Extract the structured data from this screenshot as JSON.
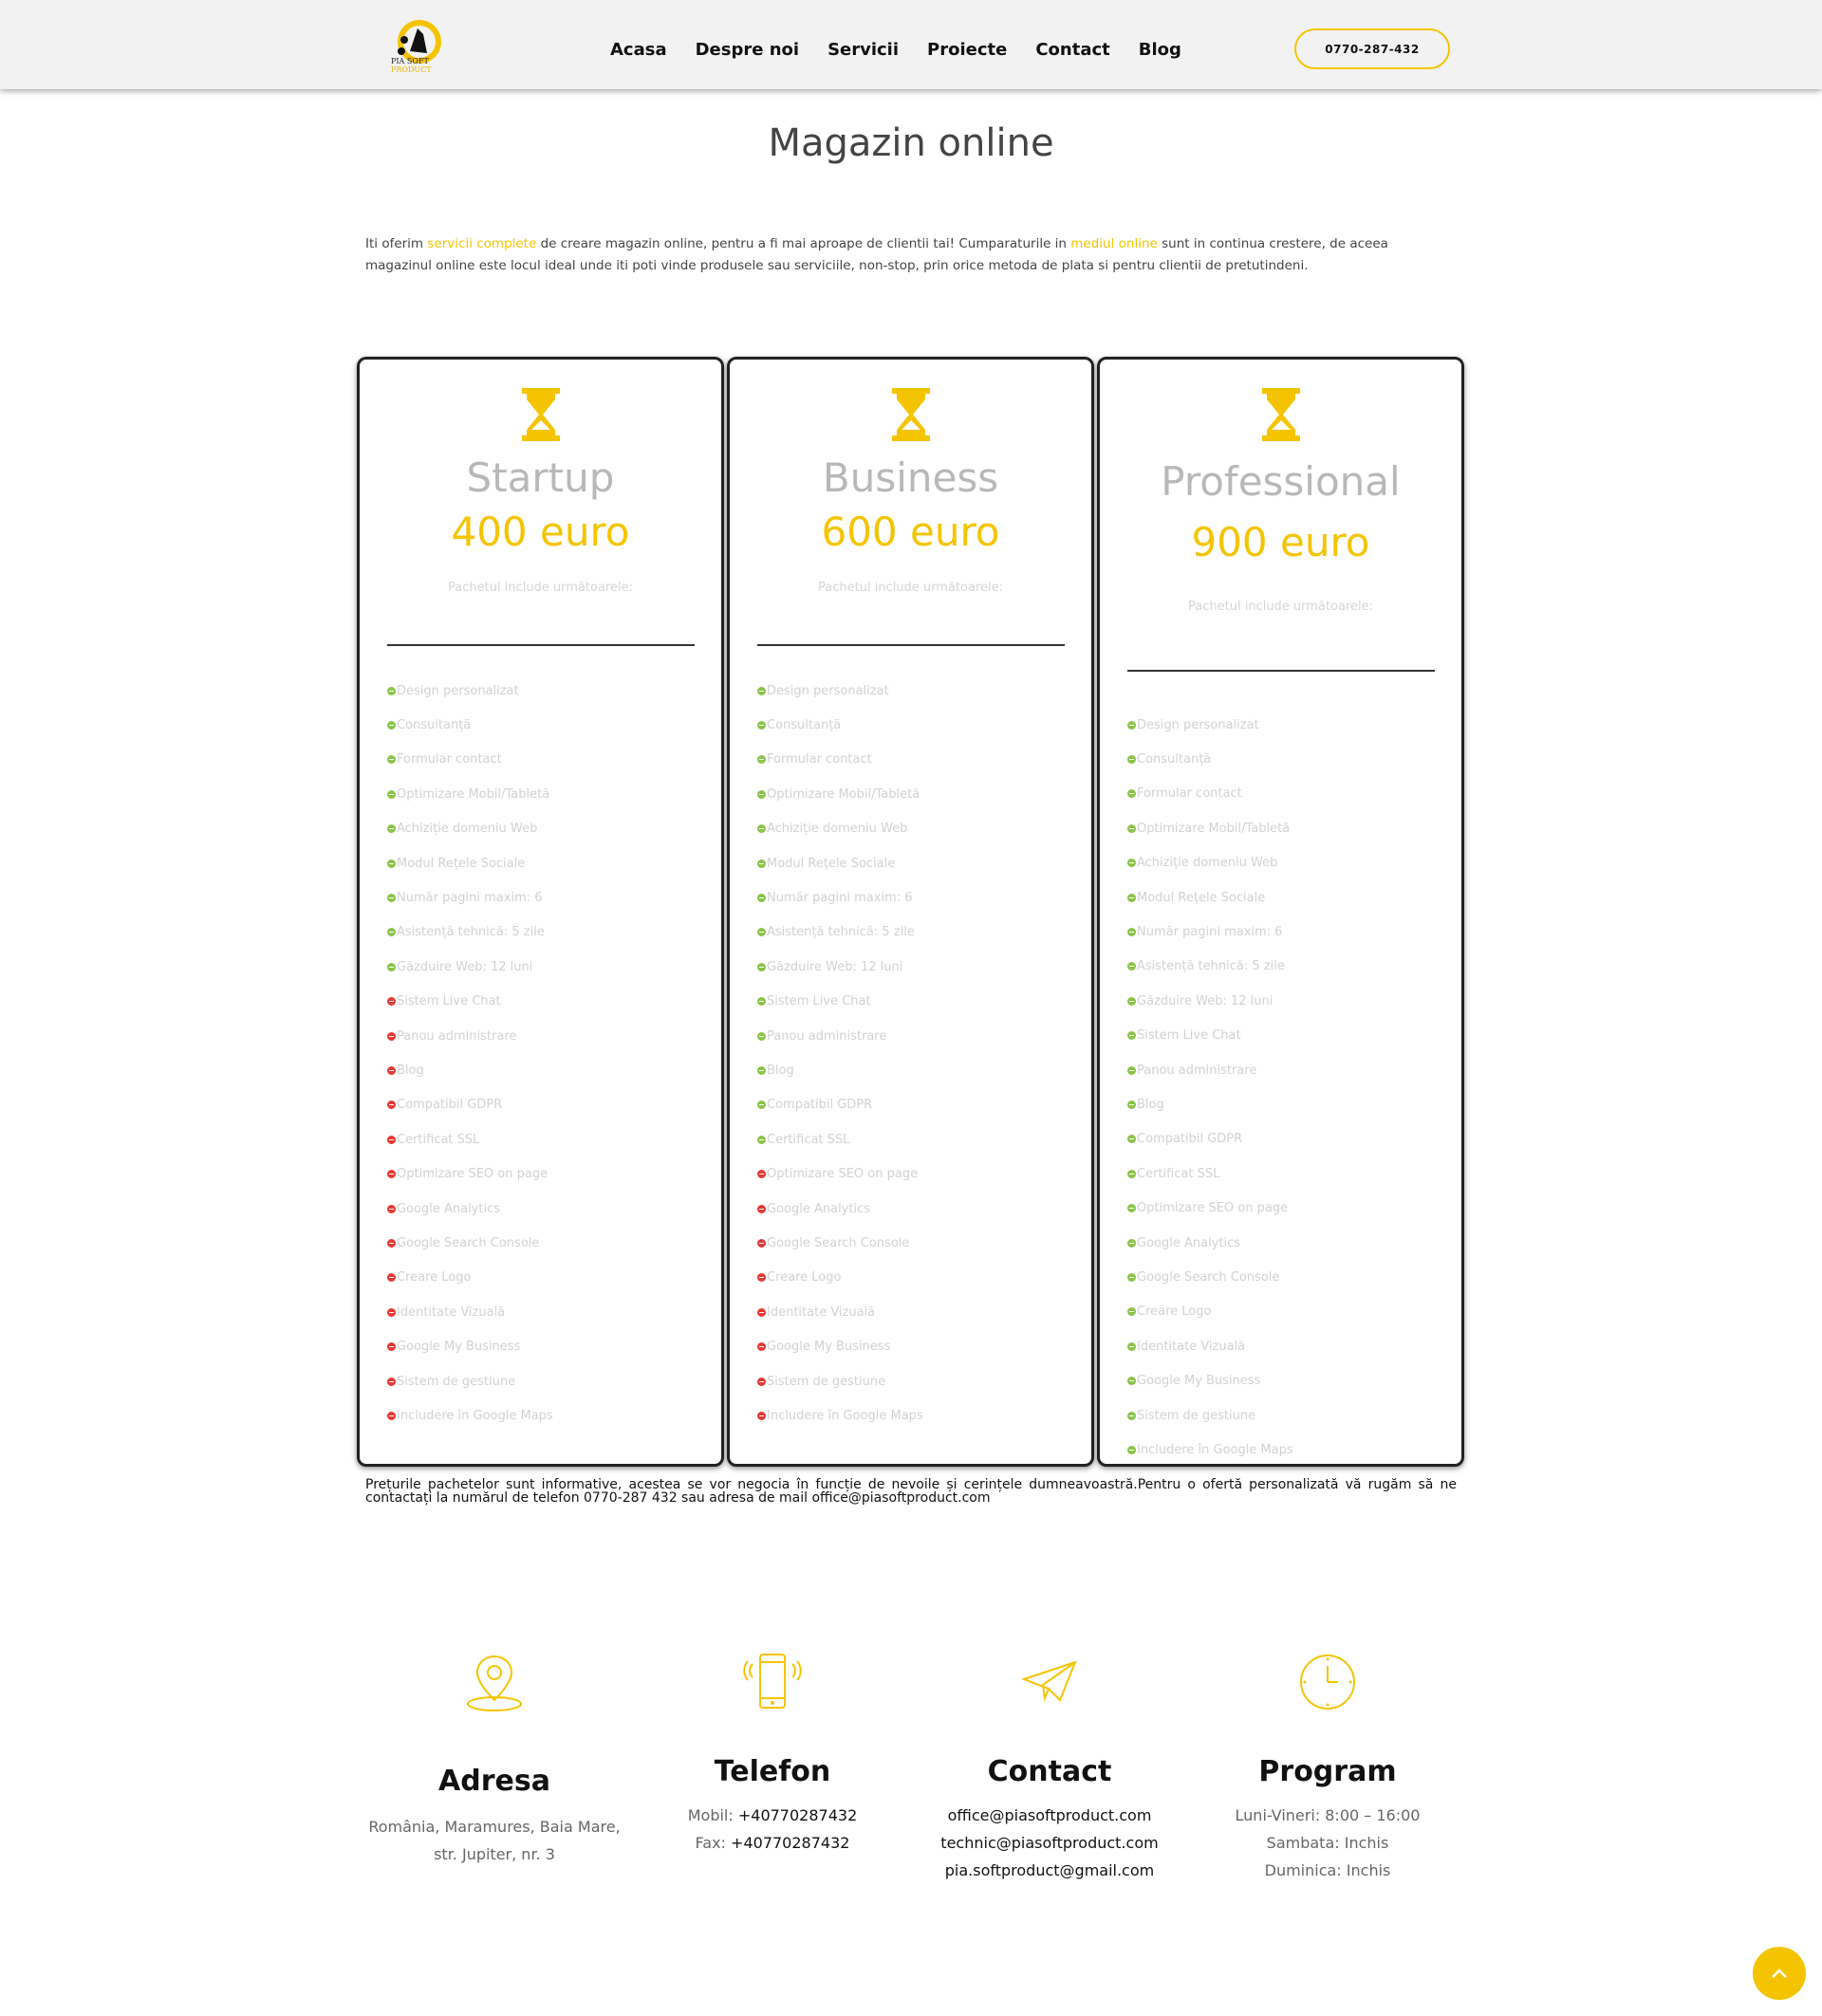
{
  "header": {
    "logo_text": "PIA SOFT",
    "logo_sub": "PRODUCT",
    "nav": [
      "Acasa",
      "Despre noi",
      "Servicii",
      "Proiecte",
      "Contact",
      "Blog"
    ],
    "phone": "0770-287-432"
  },
  "page_title": "Magazin online",
  "intro": {
    "part1": "Iti oferim ",
    "link1": "servicii complete",
    "part2": " de creare magazin online, pentru a fi mai aproape de clientii tai! Cumparaturile in ",
    "link2": "mediul online",
    "part3": " sunt in continua crestere, de aceea magazinul online este locul ideal unde iti poti vinde produsele sau serviciile, non-stop, prin orice metoda de plata si pentru clientii de pretutindeni."
  },
  "colors": {
    "accent": "#f5c400",
    "included": "#8bc34a",
    "excluded": "#e53935"
  },
  "features": [
    "Design personalizat",
    "Consultanță",
    "Formular contact",
    "Optimizare Mobil/Tabletă",
    "Achiziție domeniu Web",
    "Modul Rețele Sociale",
    "Număr pagini maxim: 6",
    "Asistență tehnică: 5 zile",
    "Găzduire Web: 12 luni",
    "Sistem Live Chat",
    "Panou administrare",
    "Blog",
    "Compatibil GDPR",
    "Certificat SSL",
    "Optimizare SEO on page",
    "Google Analytics",
    "Google Search Console",
    "Creare Logo",
    "Identitate Vizuală",
    "Google My Business",
    "Sistem de gestiune",
    "Includere în Google Maps"
  ],
  "plans": [
    {
      "name": "Startup",
      "price": "400 euro",
      "includes_label": "Pachetul include următoarele:",
      "included_count": 9
    },
    {
      "name": "Business",
      "price": "600 euro",
      "includes_label": "Pachetul include următoarele:",
      "included_count": 14
    },
    {
      "name": "Professional",
      "price": "900 euro",
      "includes_label": "Pachetul include următoarele:",
      "included_count": 22
    }
  ],
  "note": "Prețurile pachetelor sunt informative, acestea se vor negocia în funcție de nevoile și cerințele dumneavoastră.Pentru o ofertă personalizată vă rugăm să ne contactați la numărul de telefon 0770-287 432 sau adresa de mail office@piasoftproduct.com",
  "contact": {
    "address": {
      "title": "Adresa",
      "line1": "România, Maramures, Baia Mare,",
      "line2": "str. Jupiter, nr. 3"
    },
    "phone": {
      "title": "Telefon",
      "mobil_label": "Mobil:",
      "mobil": "+40770287432",
      "fax_label": "Fax:",
      "fax": "+40770287432"
    },
    "email": {
      "title": "Contact",
      "e1": "office@piasoftproduct.com",
      "e2": "technic@piasoftproduct.com",
      "e3": "pia.softproduct@gmail.com"
    },
    "schedule": {
      "title": "Program",
      "l1": "Luni-Vineri: 8:00 – 16:00",
      "l2": "Sambata: Inchis",
      "l3": "Duminica: Inchis"
    }
  },
  "icons": {
    "location": "location-pin-icon",
    "phone": "smartphone-icon",
    "email": "paper-plane-icon",
    "clock": "clock-icon",
    "plan": "hourglass-icon",
    "top": "chevron-up-icon"
  }
}
